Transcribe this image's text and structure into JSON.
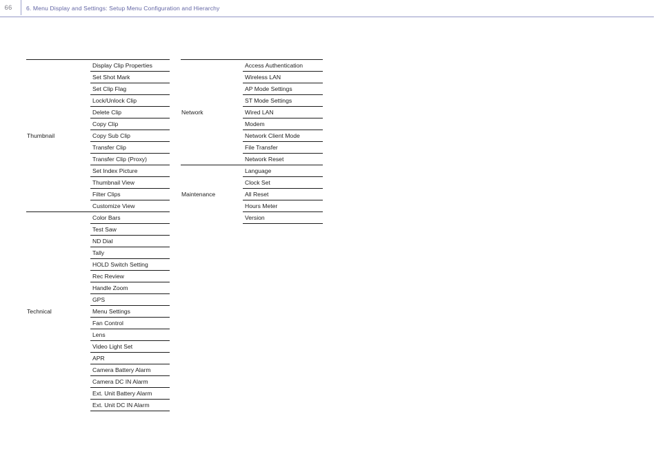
{
  "header": {
    "page_number": "66",
    "title": "6. Menu Display and Settings: Setup Menu Configuration and Hierarchy",
    "rule_color": "#9397c6",
    "title_color": "#6366a5",
    "page_number_color": "#7c7c85"
  },
  "columns": [
    {
      "position": "left",
      "groups": [
        {
          "label": "Thumbnail",
          "items": [
            "Display Clip Properties",
            "Set Shot Mark",
            "Set Clip Flag",
            "Lock/Unlock Clip",
            "Delete Clip",
            "Copy Clip",
            "Copy Sub Clip",
            "Transfer Clip",
            "Transfer Clip (Proxy)",
            "Set Index Picture",
            "Thumbnail View",
            "Filter Clips",
            "Customize View"
          ]
        },
        {
          "label": "Technical",
          "items": [
            "Color Bars",
            "Test Saw",
            "ND Dial",
            "Tally",
            "HOLD Switch Setting",
            "Rec Review",
            "Handle Zoom",
            "GPS",
            "Menu Settings",
            "Fan Control",
            "Lens",
            "Video Light Set",
            "APR",
            "Camera Battery Alarm",
            "Camera DC IN Alarm",
            "Ext. Unit Battery Alarm",
            "Ext. Unit DC IN Alarm"
          ]
        }
      ]
    },
    {
      "position": "right",
      "groups": [
        {
          "label": "Network",
          "items": [
            "Access Authentication",
            "Wireless LAN",
            "AP Mode Settings",
            "ST Mode Settings",
            "Wired LAN",
            "Modem",
            "Network Client Mode",
            "File Transfer",
            "Network Reset"
          ]
        },
        {
          "label": "Maintenance",
          "items": [
            "Language",
            "Clock Set",
            "All Reset",
            "Hours Meter",
            "Version"
          ]
        }
      ]
    }
  ]
}
